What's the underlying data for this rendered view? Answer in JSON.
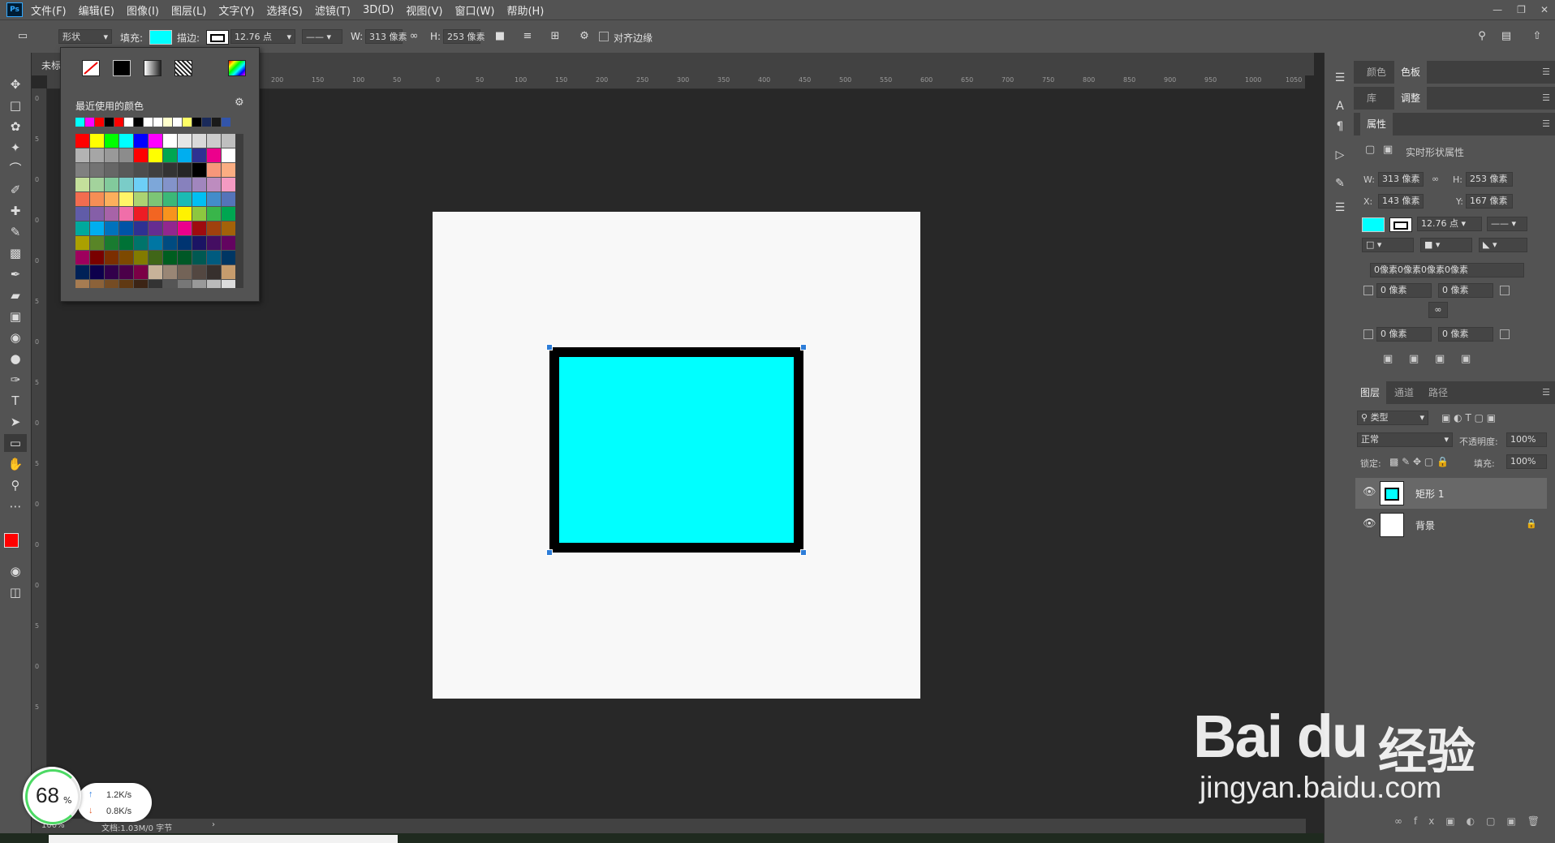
{
  "app": {
    "logo": "Ps"
  },
  "menu": [
    "文件(F)",
    "编辑(E)",
    "图像(I)",
    "图层(L)",
    "文字(Y)",
    "选择(S)",
    "滤镜(T)",
    "3D(D)",
    "视图(V)",
    "窗口(W)",
    "帮助(H)"
  ],
  "options": {
    "mode": "形状",
    "fill_label": "填充:",
    "stroke_label": "描边:",
    "stroke_width": "12.76 点",
    "w_label": "W:",
    "w_value": "313 像素",
    "h_label": "H:",
    "h_value": "253 像素",
    "align_edges": "对齐边缘"
  },
  "doc_tab": "未标",
  "ruler_ticks": [
    "200",
    "150",
    "100",
    "50",
    "0",
    "50",
    "100",
    "150",
    "200",
    "250",
    "300",
    "350",
    "400",
    "450",
    "500",
    "550",
    "600",
    "650",
    "700",
    "750",
    "800",
    "850",
    "900",
    "950",
    "1000",
    "1050"
  ],
  "ruler_ticks_v": [
    "0",
    "5",
    "0",
    "0",
    "0",
    "5",
    "0",
    "5",
    "0",
    "5",
    "0",
    "0",
    "0",
    "5",
    "0",
    "5"
  ],
  "swatches_popup": {
    "recent_label": "最近使用的颜色",
    "recent_colors": [
      "#00ffff",
      "#ff00ff",
      "#ff0000",
      "#000000",
      "#ff0000",
      "#ffffff",
      "#000000",
      "#ffffff",
      "#ffffff",
      "#ffffcc",
      "#ffffff",
      "#ffff66",
      "#000000",
      "#1a2a5a",
      "#1a1a1a",
      "#3355aa"
    ],
    "grid_colors": [
      "#ff0000",
      "#ffff00",
      "#00ff00",
      "#00ffff",
      "#0000ff",
      "#ff00ff",
      "#ffffff",
      "#e6e6e6",
      "#d9d9d9",
      "#cccccc",
      "#bfbfbf",
      "#b3b3b3",
      "#a6a6a6",
      "#999999",
      "#8c8c8c",
      "#ff0000",
      "#ffff00",
      "#00a651",
      "#00aeef",
      "#2e3192",
      "#ec008c",
      "#ffffff",
      "#808080",
      "#737373",
      "#666666",
      "#595959",
      "#4d4d4d",
      "#404040",
      "#333333",
      "#262626",
      "#000000",
      "#f7977a",
      "#fbad82",
      "#c4df9b",
      "#a3d39c",
      "#82ca9c",
      "#7accc8",
      "#6dcff6",
      "#7da7d9",
      "#8393ca",
      "#8781bd",
      "#a186be",
      "#bd8cbf",
      "#f49ac2",
      "#f26c4f",
      "#f68e55",
      "#fbaf5c",
      "#fff467",
      "#acd372",
      "#7cc576",
      "#3bb878",
      "#1abbb4",
      "#00bff3",
      "#438cca",
      "#5574b9",
      "#605ca8",
      "#855fa8",
      "#a763a8",
      "#f06ea9",
      "#ed1c24",
      "#f26522",
      "#f7941d",
      "#fff200",
      "#8dc73f",
      "#39b54a",
      "#00a651",
      "#00a99d",
      "#00aeef",
      "#0072bc",
      "#0054a6",
      "#2e3192",
      "#662d91",
      "#92278f",
      "#ec008c",
      "#9e0b0f",
      "#a0410d",
      "#a36209",
      "#aba000",
      "#598527",
      "#197b30",
      "#007236",
      "#00746b",
      "#0076a3",
      "#004b80",
      "#003471",
      "#1b1464",
      "#440e62",
      "#630460",
      "#9e005d",
      "#790000",
      "#7b2e00",
      "#7d4900",
      "#827b00",
      "#406618",
      "#005e20",
      "#005826",
      "#005952",
      "#005b7f",
      "#003663",
      "#002157",
      "#0d004c",
      "#32004b",
      "#4b0049",
      "#7b0046",
      "#c7b299",
      "#998675",
      "#736357",
      "#534741",
      "#37302d",
      "#c69c6d",
      "#a67c52",
      "#8c6239",
      "#754c24",
      "#603913",
      "#3c2415",
      "#333333",
      "#555555",
      "#777777",
      "#999999",
      "#bbbbbb",
      "#dddddd"
    ]
  },
  "status": {
    "zoom": "100%",
    "doc": "文档:1.03M/0 字节"
  },
  "right_panels": {
    "tabs_top": [
      "颜色",
      "色板"
    ],
    "tabs_adj": [
      "库",
      "调整"
    ],
    "props_tab": "属性",
    "props_title": "实时形状属性",
    "w_label": "W:",
    "w_value": "313 像素",
    "h_label": "H:",
    "h_value": "253 像素",
    "x_label": "X:",
    "x_value": "143 像素",
    "y_label": "Y:",
    "y_value": "167 像素",
    "stroke_width": "12.76 点",
    "corner_summary": "0像素0像素0像素0像素",
    "corner_tl": "0 像素",
    "corner_tr": "0 像素",
    "corner_bl": "0 像素",
    "corner_br": "0 像素",
    "layer_tabs": [
      "图层",
      "通道",
      "路径"
    ],
    "filter_kind": "类型",
    "blend_mode": "正常",
    "opacity_label": "不透明度:",
    "opacity_value": "100%",
    "lock_label": "锁定:",
    "fill_label": "填充:",
    "fill_value": "100%",
    "layers": [
      {
        "name": "矩形 1"
      },
      {
        "name": "背景"
      }
    ]
  },
  "overlay": {
    "gauge_value": "68",
    "gauge_unit": "%",
    "up_speed": "1.2K/s",
    "down_speed": "0.8K/s"
  },
  "watermark": {
    "brand": "Bai du",
    "brand_cn": "经验",
    "url": "jingyan.baidu.com"
  },
  "colors": {
    "fill": "#00ffff",
    "stroke": "#000000",
    "foreground": "#ff0000",
    "background": "#000000",
    "accent": "#31a8ff"
  }
}
